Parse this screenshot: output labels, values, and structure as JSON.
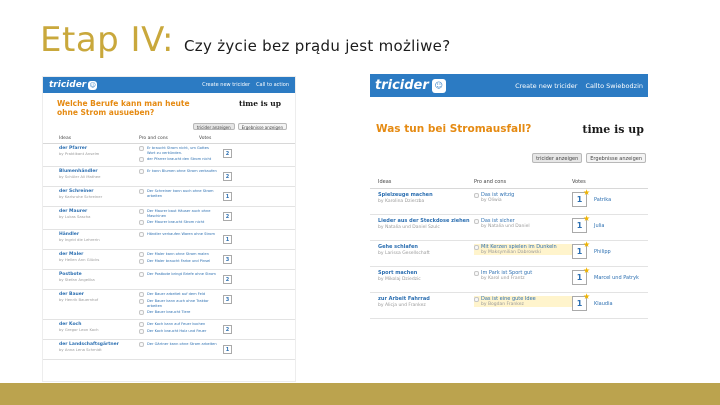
{
  "slide": {
    "title": "Etap IV:",
    "subtitle": "Czy życie bez prądu jest możliwe?"
  },
  "left_panel": {
    "logo": "tricider",
    "nav": [
      "Create new tricider",
      "Call to action"
    ],
    "question": "Welche Berufe kann man heute ohne Strom ausueben?",
    "time_up": "time is up",
    "buttons": [
      "tricider anzeigen",
      "Ergebnisse anzeigen"
    ],
    "columns": [
      "Ideas",
      "Pro and cons",
      "Votes"
    ],
    "rows": [
      {
        "idea": "der Pfarrer",
        "by": "by Praktikant Anselm",
        "props": [
          "Er braucht Strom nicht, um Gottes Wort zu verkünden.",
          "der Pfarrer braucht den Strom nicht"
        ],
        "votes": "2"
      },
      {
        "idea": "Blumenhändler",
        "by": "by Schüler Ali Mathee",
        "props": [
          "Er kann Blumen ohne Strom verkaufen"
        ],
        "votes": "2"
      },
      {
        "idea": "der Schreiner",
        "by": "by Karlsruhe Schreiner",
        "props": [
          "Der Schreiner kann auch ohne Strom arbeiten"
        ],
        "votes": "1"
      },
      {
        "idea": "der Maurer",
        "by": "by Lukas Sascha",
        "props": [
          "Der Maurer baut Häuser auch ohne Maschinen",
          "Der Maurer braucht Strom nicht"
        ],
        "votes": "2"
      },
      {
        "idea": "Händler",
        "by": "by Ingrid die Lehrerin",
        "props": [
          "Händler verkaufen Waren ohne Strom"
        ],
        "votes": "1"
      },
      {
        "idea": "der Maler",
        "by": "by Hellen Ann Glücks",
        "props": [
          "Der Maler kann ohne Strom malen",
          "Der Maler braucht Farbe und Pinsel"
        ],
        "votes": "3"
      },
      {
        "idea": "Postbote",
        "by": "by Stefan Angelika",
        "props": [
          "Der Postbote bringt Briefe ohne Strom"
        ],
        "votes": "2"
      },
      {
        "idea": "der Bauer",
        "by": "by Henrik Bauernhof",
        "props": [
          "Der Bauer arbeitet auf dem Feld",
          "Der Bauer kann auch ohne Traktor arbeiten",
          "Der Bauer braucht Tiere"
        ],
        "votes": "3"
      },
      {
        "idea": "der Koch",
        "by": "by Gregor Leon Koch",
        "props": [
          "Der Koch kann auf Feuer kochen",
          "Der Koch braucht Holz und Feuer"
        ],
        "votes": "2"
      },
      {
        "idea": "der Landschaftsgärtner",
        "by": "by Anna Lena Schmidt",
        "props": [
          "Der Gärtner kann ohne Strom arbeiten"
        ],
        "votes": "1"
      }
    ]
  },
  "right_panel": {
    "logo": "tricider",
    "nav": [
      "Create new tricider",
      "Callto Swiebodzin"
    ],
    "question": "Was tun bei Stromausfall?",
    "time_up": "time is up",
    "buttons": [
      "tricider anzeigen",
      "Ergebnisse anzeigen"
    ],
    "columns": [
      "Ideas",
      "Pro and cons",
      "Votes"
    ],
    "rows": [
      {
        "idea": "Spielzeuge machen",
        "by": "by Karolina Dzierzba",
        "prop": "Das ist witzig",
        "prop_by": "by Oliwia",
        "votes": "1",
        "voter": "Patrika",
        "highlight": false
      },
      {
        "idea": "Lieder aus der Steckdose ziehen",
        "by": "by Natalia und Daniel Szulc",
        "prop": "Das ist sicher",
        "prop_by": "by Natalia und Daniel",
        "votes": "1",
        "voter": "Julia",
        "highlight": false
      },
      {
        "idea": "Gehe schlafen",
        "by": "by Larissa Gesellschaft",
        "prop": "Mit Kerzen spielen im Dunkeln",
        "prop_by": "by Maksymilian Dabrowski",
        "votes": "1",
        "voter": "Philipp",
        "highlight": true
      },
      {
        "idea": "Sport machen",
        "by": "by Mikolaj Dziedzic",
        "prop": "Im Park ist Sport gut",
        "prop_by": "by Karol und Frantz",
        "votes": "1",
        "voter": "Marcel und Patryk",
        "highlight": false
      },
      {
        "idea": "zur Arbeit Fahrrad",
        "by": "by Alicja und Frankez",
        "prop": "Das ist eine gute Idee",
        "prop_by": "by Bogdan Frankez",
        "votes": "1",
        "voter": "Klaudia",
        "highlight": true
      }
    ]
  },
  "colors": {
    "title_gold": "#c9a83c",
    "header_blue": "#2c7bc3",
    "question_orange": "#e58a12",
    "footer_bar": "#bba34e"
  }
}
